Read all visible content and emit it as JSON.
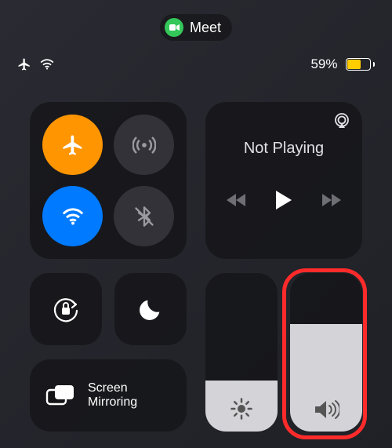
{
  "pill": {
    "app_label": "Meet"
  },
  "status": {
    "battery_pct": "59%",
    "battery_level": 59
  },
  "connectivity": {
    "airplane": "airplane-mode",
    "cellular": "cellular-data",
    "wifi": "wifi",
    "bluetooth": "bluetooth"
  },
  "now_playing": {
    "title": "Not Playing"
  },
  "tiles": {
    "orientation_lock": "orientation-lock",
    "dnd": "do-not-disturb",
    "screen_mirroring_label": "Screen\nMirroring"
  },
  "sliders": {
    "brightness_pct": 32,
    "volume_pct": 68
  }
}
